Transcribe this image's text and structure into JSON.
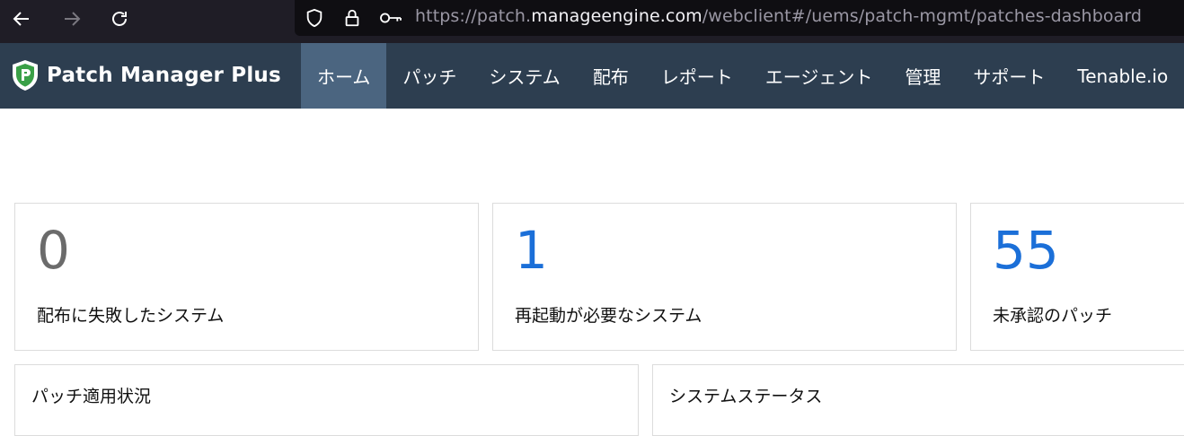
{
  "browser": {
    "url_prefix": "https://patch.",
    "url_domain": "manageengine.com",
    "url_path": "/webclient#/uems/patch-mgmt/patches-dashboard",
    "icons": [
      "back-arrow-icon",
      "forward-arrow-icon",
      "reload-icon",
      "shield-icon",
      "lock-icon",
      "key-icon"
    ]
  },
  "app": {
    "name": "Patch Manager Plus",
    "brand_color": "#2d3e50",
    "active_color": "#4b6580",
    "menu": [
      {
        "label": "ホーム",
        "active": true
      },
      {
        "label": "パッチ"
      },
      {
        "label": "システム"
      },
      {
        "label": "配布"
      },
      {
        "label": "レポート"
      },
      {
        "label": "エージェント"
      },
      {
        "label": "管理"
      },
      {
        "label": "サポート"
      },
      {
        "label": "Tenable.io"
      }
    ]
  },
  "metrics": [
    {
      "value": "0",
      "label": "配布に失敗したシステム",
      "color": "#6b6b6b"
    },
    {
      "value": "1",
      "label": "再起動が必要なシステム",
      "color": "#1b6fd8"
    },
    {
      "value": "55",
      "label": "未承認のパッチ",
      "color": "#1b6fd8"
    }
  ],
  "panels": [
    {
      "title": "パッチ適用状況"
    },
    {
      "title": "システムステータス"
    }
  ]
}
